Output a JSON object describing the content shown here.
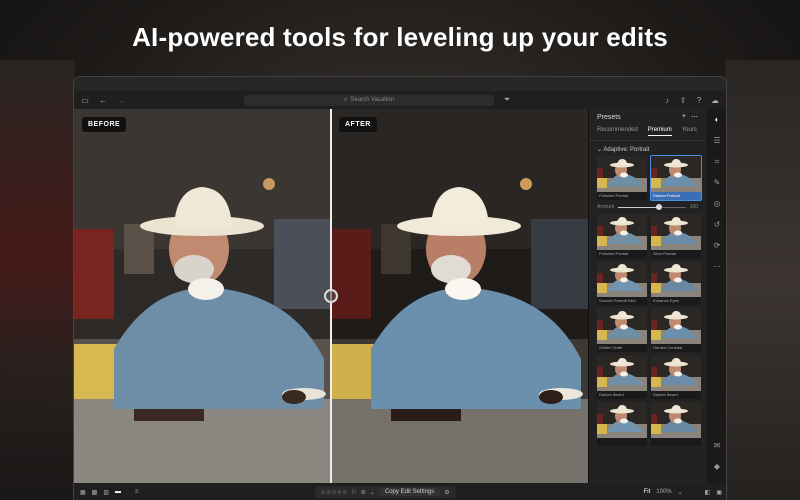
{
  "headline": "AI-powered tools for leveling up your edits",
  "toolbar": {
    "search_placeholder": "Search Vacation"
  },
  "photo": {
    "before_label": "BEFORE",
    "after_label": "AFTER"
  },
  "panel": {
    "title": "Presets",
    "tabs": [
      "Recommended",
      "Premium",
      "Yours"
    ],
    "active_tab": "Premium",
    "group_title": "Adaptive: Portrait",
    "amount_label": "Amount",
    "amount_value": "100",
    "amount_fraction": 0.6,
    "presets": [
      {
        "name": "Polished Portrait",
        "selected": false
      },
      {
        "name": "Darken Portrait",
        "selected": true
      },
      {
        "name": "Polished Portrait",
        "selected": false
      },
      {
        "name": "Glow Portrait",
        "selected": false
      },
      {
        "name": "Smooth Portrait Skin",
        "selected": false
      },
      {
        "name": "Enhance Eyes",
        "selected": false
      },
      {
        "name": "Whiten Teeth",
        "selected": false
      },
      {
        "name": "Harden Contrast",
        "selected": false
      },
      {
        "name": "Darken Beard",
        "selected": false
      },
      {
        "name": "Darken Beard",
        "selected": false
      },
      {
        "name": "",
        "selected": false
      },
      {
        "name": "",
        "selected": false
      }
    ]
  },
  "bottombar": {
    "copy_label": "Copy Edit Settings",
    "fit_label": "Fit",
    "zoom_label": "100%"
  },
  "colors": {
    "accent": "#4a90e2",
    "panel_bg": "#222222",
    "window_bg": "#1c1c1c"
  }
}
